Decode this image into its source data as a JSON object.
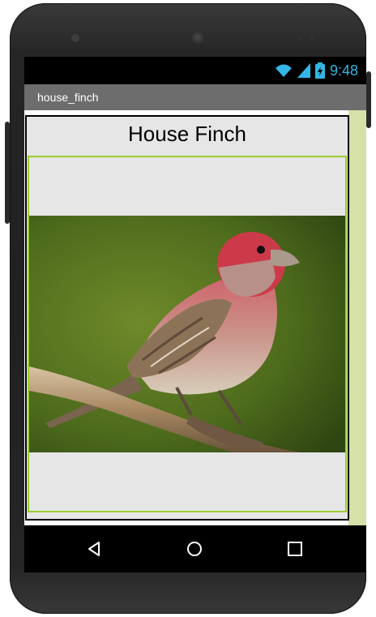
{
  "status_bar": {
    "time": "9:48",
    "icons": [
      "wifi-icon",
      "signal-icon",
      "battery-icon"
    ],
    "accent_color": "#33b5e5"
  },
  "app_bar": {
    "title": "house_finch",
    "color": "#6d6d6d"
  },
  "screen": {
    "heading": "House Finch",
    "image": {
      "subject": "house finch on branch",
      "border_color": "#9acd32"
    },
    "side_strip_color": "#d5e1a9"
  },
  "nav_bar": {
    "buttons": [
      "back-icon",
      "home-icon",
      "recents-icon"
    ]
  }
}
